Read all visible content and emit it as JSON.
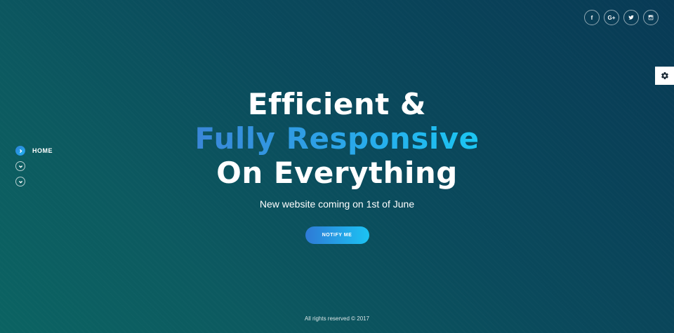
{
  "social": [
    {
      "name": "facebook-icon",
      "glyph": "f"
    },
    {
      "name": "google-plus-icon",
      "glyph": "G+"
    },
    {
      "name": "twitter-icon",
      "glyph": ""
    },
    {
      "name": "instagram-icon",
      "glyph": ""
    }
  ],
  "settings": {
    "icon": "gear-icon"
  },
  "nav": {
    "items": [
      {
        "label": "HOME",
        "active": true
      },
      {
        "label": "",
        "active": false
      },
      {
        "label": "",
        "active": false
      }
    ]
  },
  "hero": {
    "line1": "Efficient &",
    "line2": "Fully Responsive",
    "line3": "On Everything",
    "subtitle": "New website coming on 1st of June",
    "button_label": "NOTIFY ME"
  },
  "footer": {
    "text": "All rights reserved © 2017"
  },
  "colors": {
    "accent_start": "#2e7ad6",
    "accent_end": "#1cc3f3",
    "bg_dark": "#083a55",
    "bg_teal": "#0b6362"
  }
}
